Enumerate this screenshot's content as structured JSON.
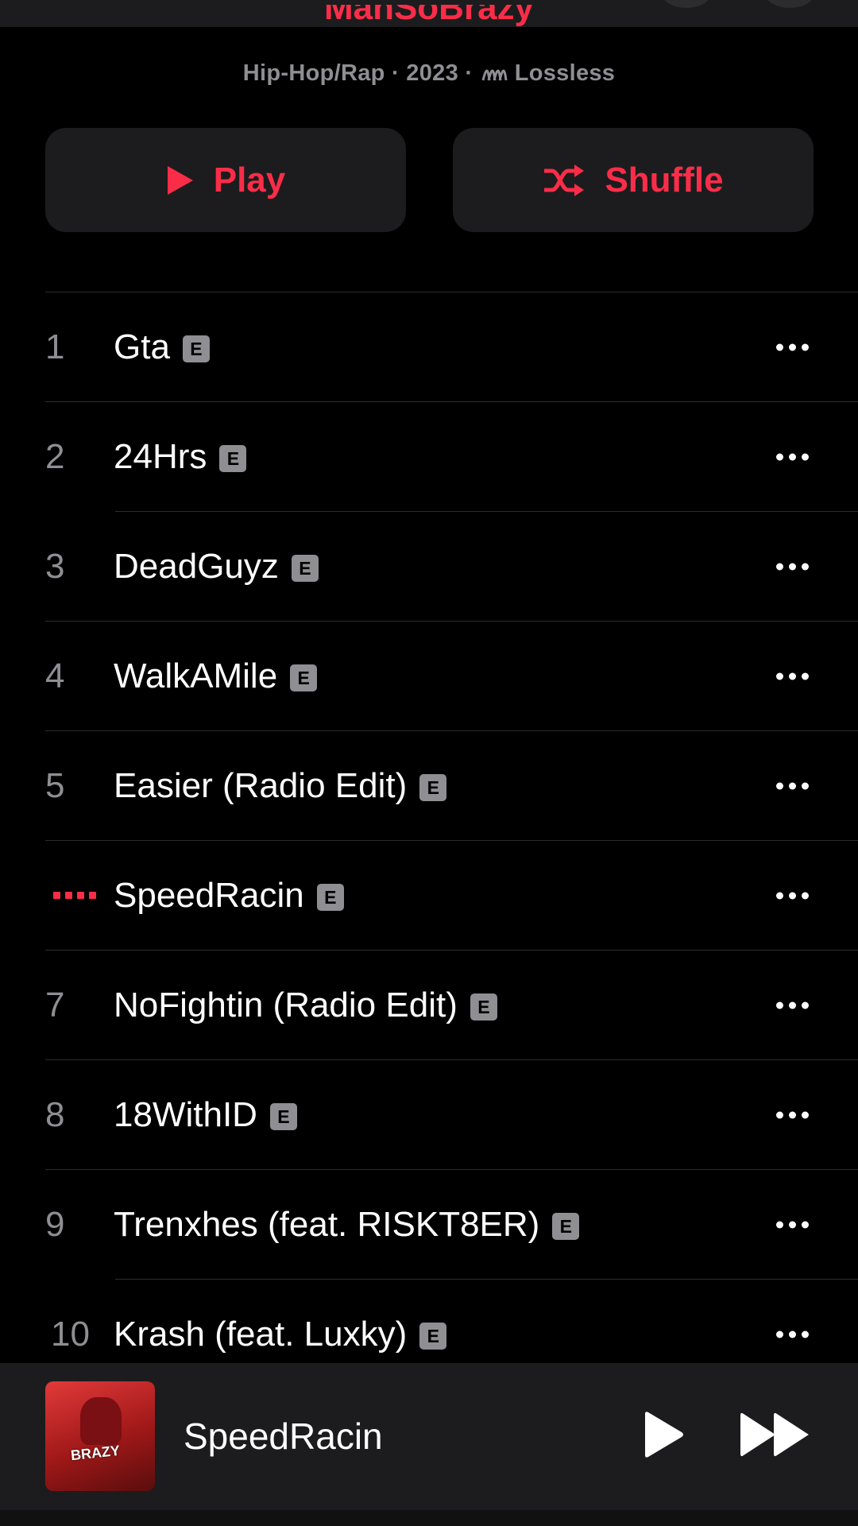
{
  "header": {
    "artist": "ManSoBrazy",
    "meta_genre_year": "Hip-Hop/Rap · 2023 · ",
    "meta_quality": "Lossless"
  },
  "actions": {
    "play_label": "Play",
    "shuffle_label": "Shuffle"
  },
  "accent_color": "#fa2d48",
  "tracks": [
    {
      "number": "1",
      "title": "Gta",
      "explicit_badge": "E"
    },
    {
      "number": "2",
      "title": "24Hrs",
      "explicit_badge": "E"
    },
    {
      "number": "3",
      "title": "DeadGuyz",
      "explicit_badge": "E"
    },
    {
      "number": "4",
      "title": "WalkAMile",
      "explicit_badge": "E"
    },
    {
      "number": "5",
      "title": "Easier (Radio Edit)",
      "explicit_badge": "E"
    },
    {
      "number": "",
      "title": "SpeedRacin",
      "explicit_badge": "E",
      "now_playing": true
    },
    {
      "number": "7",
      "title": "NoFightin (Radio Edit)",
      "explicit_badge": "E"
    },
    {
      "number": "8",
      "title": "18WithID",
      "explicit_badge": "E"
    },
    {
      "number": "9",
      "title": "Trenxhes (feat. RISKT8ER)",
      "explicit_badge": "E"
    },
    {
      "number": "10",
      "title": "Krash (feat. Luxky)",
      "explicit_badge": "E"
    }
  ],
  "mini_player": {
    "title": "SpeedRacin",
    "artwork_text": "BRAZY"
  }
}
